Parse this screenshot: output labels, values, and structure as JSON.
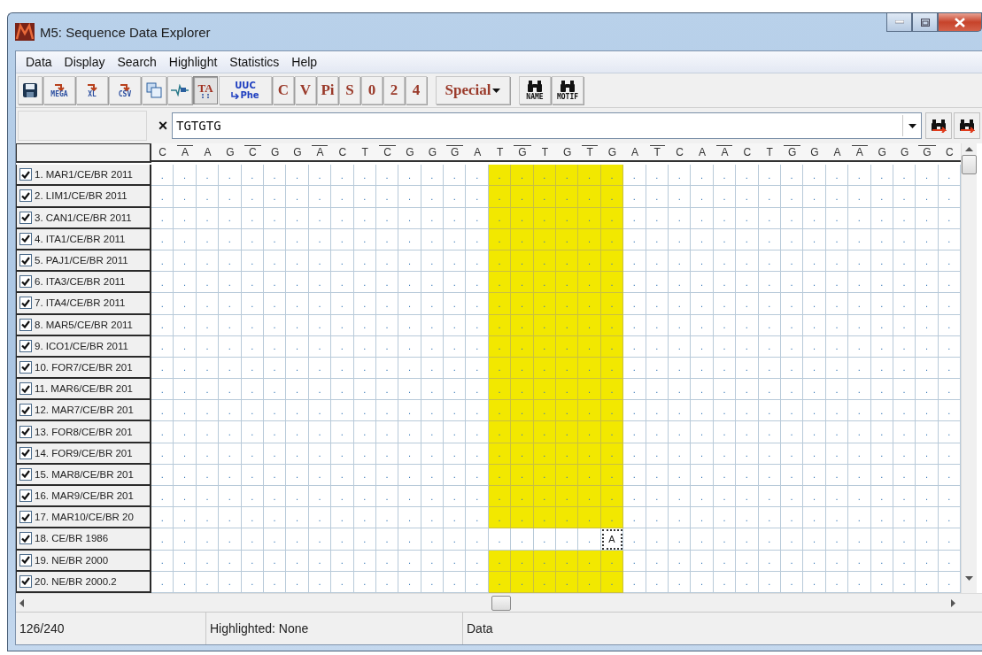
{
  "window": {
    "title": "M5: Sequence Data Explorer"
  },
  "menu": [
    "Data",
    "Display",
    "Search",
    "Highlight",
    "Statistics",
    "Help"
  ],
  "toolbar": [
    {
      "kind": "save"
    },
    {
      "kind": "export",
      "label": "MEGA"
    },
    {
      "kind": "export",
      "label": "XL"
    },
    {
      "kind": "export",
      "label": "CSV"
    },
    {
      "kind": "copy"
    },
    {
      "kind": "chart"
    },
    {
      "kind": "toggle",
      "label": "TA",
      "pressed": true
    },
    {
      "kind": "translate",
      "label": "UUC",
      "sub": "Phe"
    },
    {
      "kind": "letter",
      "label": "C",
      "pressed": false
    },
    {
      "kind": "letter",
      "label": "V",
      "pressed": false
    },
    {
      "kind": "letter",
      "label": "Pi",
      "pressed": false
    },
    {
      "kind": "letter",
      "label": "S",
      "pressed": false
    },
    {
      "kind": "letter",
      "label": "0",
      "pressed": false
    },
    {
      "kind": "letter",
      "label": "2",
      "pressed": false
    },
    {
      "kind": "letter",
      "label": "4",
      "pressed": false
    },
    {
      "kind": "dropdown",
      "label": "Special"
    },
    {
      "kind": "find",
      "label": "NAME"
    },
    {
      "kind": "find",
      "label": "MOTIF"
    }
  ],
  "search": {
    "clear": "×",
    "value": "TGTGTG"
  },
  "columns": [
    {
      "base": "C",
      "marked": false,
      "match": false,
      "cursor": false
    },
    {
      "base": "A",
      "marked": true,
      "match": false,
      "cursor": false
    },
    {
      "base": "A",
      "marked": false,
      "match": false,
      "cursor": false
    },
    {
      "base": "G",
      "marked": false,
      "match": false,
      "cursor": false
    },
    {
      "base": "C",
      "marked": true,
      "match": false,
      "cursor": false
    },
    {
      "base": "G",
      "marked": false,
      "match": false,
      "cursor": false
    },
    {
      "base": "G",
      "marked": false,
      "match": false,
      "cursor": false
    },
    {
      "base": "A",
      "marked": true,
      "match": false,
      "cursor": false
    },
    {
      "base": "C",
      "marked": false,
      "match": false,
      "cursor": false
    },
    {
      "base": "T",
      "marked": false,
      "match": false,
      "cursor": false
    },
    {
      "base": "C",
      "marked": true,
      "match": false,
      "cursor": false
    },
    {
      "base": "G",
      "marked": false,
      "match": false,
      "cursor": false
    },
    {
      "base": "G",
      "marked": false,
      "match": false,
      "cursor": false
    },
    {
      "base": "G",
      "marked": true,
      "match": false,
      "cursor": false
    },
    {
      "base": "A",
      "marked": false,
      "match": false,
      "cursor": false
    },
    {
      "base": "T",
      "marked": false,
      "match": true,
      "cursor": false
    },
    {
      "base": "G",
      "marked": true,
      "match": true,
      "cursor": false
    },
    {
      "base": "T",
      "marked": false,
      "match": true,
      "cursor": false
    },
    {
      "base": "G",
      "marked": false,
      "match": true,
      "cursor": false
    },
    {
      "base": "T",
      "marked": true,
      "match": true,
      "cursor": false
    },
    {
      "base": "G",
      "marked": false,
      "match": true,
      "cursor": true
    },
    {
      "base": "A",
      "marked": false,
      "match": false,
      "cursor": false
    },
    {
      "base": "T",
      "marked": true,
      "match": false,
      "cursor": false
    },
    {
      "base": "C",
      "marked": false,
      "match": false,
      "cursor": false
    },
    {
      "base": "A",
      "marked": false,
      "match": false,
      "cursor": false
    },
    {
      "base": "A",
      "marked": true,
      "match": false,
      "cursor": false
    },
    {
      "base": "C",
      "marked": false,
      "match": false,
      "cursor": false
    },
    {
      "base": "T",
      "marked": false,
      "match": false,
      "cursor": false
    },
    {
      "base": "G",
      "marked": true,
      "match": false,
      "cursor": false
    },
    {
      "base": "G",
      "marked": false,
      "match": false,
      "cursor": false
    },
    {
      "base": "A",
      "marked": false,
      "match": false,
      "cursor": false
    },
    {
      "base": "A",
      "marked": true,
      "match": false,
      "cursor": false
    },
    {
      "base": "G",
      "marked": false,
      "match": false,
      "cursor": false
    },
    {
      "base": "G",
      "marked": false,
      "match": false,
      "cursor": false
    },
    {
      "base": "G",
      "marked": true,
      "match": false,
      "cursor": false
    },
    {
      "base": "C",
      "marked": false,
      "match": false,
      "cursor": false
    }
  ],
  "rows": [
    {
      "label": "1. MAR1/CE/BR 2011",
      "checked": true,
      "highlighted": true,
      "cursor": false,
      "cells": [
        ".",
        ".",
        ".",
        ".",
        ".",
        ".",
        ".",
        ".",
        ".",
        ".",
        ".",
        ".",
        ".",
        ".",
        ".",
        ".",
        ".",
        ".",
        ".",
        ".",
        ".",
        ".",
        ".",
        ".",
        ".",
        ".",
        ".",
        ".",
        ".",
        ".",
        ".",
        ".",
        ".",
        ".",
        ".",
        "."
      ]
    },
    {
      "label": "2. LIM1/CE/BR 2011",
      "checked": true,
      "highlighted": true,
      "cursor": false,
      "cells": [
        ".",
        ".",
        ".",
        ".",
        ".",
        ".",
        ".",
        ".",
        ".",
        ".",
        ".",
        ".",
        ".",
        ".",
        ".",
        ".",
        ".",
        ".",
        ".",
        ".",
        ".",
        ".",
        ".",
        ".",
        ".",
        ".",
        ".",
        ".",
        ".",
        ".",
        ".",
        ".",
        ".",
        ".",
        ".",
        "."
      ]
    },
    {
      "label": "3. CAN1/CE/BR 2011",
      "checked": true,
      "highlighted": true,
      "cursor": false,
      "cells": [
        ".",
        ".",
        ".",
        ".",
        ".",
        ".",
        ".",
        ".",
        ".",
        ".",
        ".",
        ".",
        ".",
        ".",
        ".",
        ".",
        ".",
        ".",
        ".",
        ".",
        ".",
        ".",
        ".",
        ".",
        ".",
        ".",
        ".",
        ".",
        ".",
        ".",
        ".",
        ".",
        ".",
        ".",
        ".",
        "."
      ]
    },
    {
      "label": "4. ITA1/CE/BR 2011",
      "checked": true,
      "highlighted": true,
      "cursor": false,
      "cells": [
        ".",
        ".",
        ".",
        ".",
        ".",
        ".",
        ".",
        ".",
        ".",
        ".",
        ".",
        ".",
        ".",
        ".",
        ".",
        ".",
        ".",
        ".",
        ".",
        ".",
        ".",
        ".",
        ".",
        ".",
        ".",
        ".",
        ".",
        ".",
        ".",
        ".",
        ".",
        ".",
        ".",
        ".",
        ".",
        "."
      ]
    },
    {
      "label": "5. PAJ1/CE/BR 2011",
      "checked": true,
      "highlighted": true,
      "cursor": false,
      "cells": [
        ".",
        ".",
        ".",
        ".",
        ".",
        ".",
        ".",
        ".",
        ".",
        ".",
        ".",
        ".",
        ".",
        ".",
        ".",
        ".",
        ".",
        ".",
        ".",
        ".",
        ".",
        ".",
        ".",
        ".",
        ".",
        ".",
        ".",
        ".",
        ".",
        ".",
        ".",
        ".",
        ".",
        ".",
        ".",
        "."
      ]
    },
    {
      "label": "6. ITA3/CE/BR 2011",
      "checked": true,
      "highlighted": true,
      "cursor": false,
      "cells": [
        ".",
        ".",
        ".",
        ".",
        ".",
        ".",
        ".",
        ".",
        ".",
        ".",
        ".",
        ".",
        ".",
        ".",
        ".",
        ".",
        ".",
        ".",
        ".",
        ".",
        ".",
        ".",
        ".",
        ".",
        ".",
        ".",
        ".",
        ".",
        ".",
        ".",
        ".",
        ".",
        ".",
        ".",
        ".",
        "."
      ]
    },
    {
      "label": "7. ITA4/CE/BR 2011",
      "checked": true,
      "highlighted": true,
      "cursor": false,
      "cells": [
        ".",
        ".",
        ".",
        ".",
        ".",
        ".",
        ".",
        ".",
        ".",
        ".",
        ".",
        ".",
        ".",
        ".",
        ".",
        ".",
        ".",
        ".",
        ".",
        ".",
        ".",
        ".",
        ".",
        ".",
        ".",
        ".",
        ".",
        ".",
        ".",
        ".",
        ".",
        ".",
        ".",
        ".",
        ".",
        "."
      ]
    },
    {
      "label": "8. MAR5/CE/BR 2011",
      "checked": true,
      "highlighted": true,
      "cursor": false,
      "cells": [
        ".",
        ".",
        ".",
        ".",
        ".",
        ".",
        ".",
        ".",
        ".",
        ".",
        ".",
        ".",
        ".",
        ".",
        ".",
        ".",
        ".",
        ".",
        ".",
        ".",
        ".",
        ".",
        ".",
        ".",
        ".",
        ".",
        ".",
        ".",
        ".",
        ".",
        ".",
        ".",
        ".",
        ".",
        ".",
        "."
      ]
    },
    {
      "label": "9. ICO1/CE/BR 2011",
      "checked": true,
      "highlighted": true,
      "cursor": false,
      "cells": [
        ".",
        ".",
        ".",
        ".",
        ".",
        ".",
        ".",
        ".",
        ".",
        ".",
        ".",
        ".",
        ".",
        ".",
        ".",
        ".",
        ".",
        ".",
        ".",
        ".",
        ".",
        ".",
        ".",
        ".",
        ".",
        ".",
        ".",
        ".",
        ".",
        ".",
        ".",
        ".",
        ".",
        ".",
        ".",
        "."
      ]
    },
    {
      "label": "10. FOR7/CE/BR 201",
      "checked": true,
      "highlighted": true,
      "cursor": false,
      "cells": [
        ".",
        ".",
        ".",
        ".",
        ".",
        ".",
        ".",
        ".",
        ".",
        ".",
        ".",
        ".",
        ".",
        ".",
        ".",
        ".",
        ".",
        ".",
        ".",
        ".",
        ".",
        ".",
        ".",
        ".",
        ".",
        ".",
        ".",
        ".",
        ".",
        ".",
        ".",
        ".",
        ".",
        ".",
        ".",
        "."
      ]
    },
    {
      "label": "11. MAR6/CE/BR 201",
      "checked": true,
      "highlighted": true,
      "cursor": false,
      "cells": [
        ".",
        ".",
        ".",
        ".",
        ".",
        ".",
        ".",
        ".",
        ".",
        ".",
        ".",
        ".",
        ".",
        ".",
        ".",
        ".",
        ".",
        ".",
        ".",
        ".",
        ".",
        ".",
        ".",
        ".",
        ".",
        ".",
        ".",
        ".",
        ".",
        ".",
        ".",
        ".",
        ".",
        ".",
        ".",
        "."
      ]
    },
    {
      "label": "12. MAR7/CE/BR 201",
      "checked": true,
      "highlighted": true,
      "cursor": false,
      "cells": [
        ".",
        ".",
        ".",
        ".",
        ".",
        ".",
        ".",
        ".",
        ".",
        ".",
        ".",
        ".",
        ".",
        ".",
        ".",
        ".",
        ".",
        ".",
        ".",
        ".",
        ".",
        ".",
        ".",
        ".",
        ".",
        ".",
        ".",
        ".",
        ".",
        ".",
        ".",
        ".",
        ".",
        ".",
        ".",
        "."
      ]
    },
    {
      "label": "13. FOR8/CE/BR 201",
      "checked": true,
      "highlighted": true,
      "cursor": false,
      "cells": [
        ".",
        ".",
        ".",
        ".",
        ".",
        ".",
        ".",
        ".",
        ".",
        ".",
        ".",
        ".",
        ".",
        ".",
        ".",
        ".",
        ".",
        ".",
        ".",
        ".",
        ".",
        ".",
        ".",
        ".",
        ".",
        ".",
        ".",
        ".",
        ".",
        ".",
        ".",
        ".",
        ".",
        ".",
        ".",
        "."
      ]
    },
    {
      "label": "14. FOR9/CE/BR 201",
      "checked": true,
      "highlighted": true,
      "cursor": false,
      "cells": [
        ".",
        ".",
        ".",
        ".",
        ".",
        ".",
        ".",
        ".",
        ".",
        ".",
        ".",
        ".",
        ".",
        ".",
        ".",
        ".",
        ".",
        ".",
        ".",
        ".",
        ".",
        ".",
        ".",
        ".",
        ".",
        ".",
        ".",
        ".",
        ".",
        ".",
        ".",
        ".",
        ".",
        ".",
        ".",
        "."
      ]
    },
    {
      "label": "15. MAR8/CE/BR 201",
      "checked": true,
      "highlighted": true,
      "cursor": false,
      "cells": [
        ".",
        ".",
        ".",
        ".",
        ".",
        ".",
        ".",
        ".",
        ".",
        ".",
        ".",
        ".",
        ".",
        ".",
        ".",
        ".",
        ".",
        ".",
        ".",
        ".",
        ".",
        ".",
        ".",
        ".",
        ".",
        ".",
        ".",
        ".",
        ".",
        ".",
        ".",
        ".",
        ".",
        ".",
        ".",
        "."
      ]
    },
    {
      "label": "16. MAR9/CE/BR 201",
      "checked": true,
      "highlighted": true,
      "cursor": false,
      "cells": [
        ".",
        ".",
        ".",
        ".",
        ".",
        ".",
        ".",
        ".",
        ".",
        ".",
        ".",
        ".",
        ".",
        ".",
        ".",
        ".",
        ".",
        ".",
        ".",
        ".",
        ".",
        ".",
        ".",
        ".",
        ".",
        ".",
        ".",
        ".",
        ".",
        ".",
        ".",
        ".",
        ".",
        ".",
        ".",
        "."
      ]
    },
    {
      "label": "17. MAR10/CE/BR 20",
      "checked": true,
      "highlighted": true,
      "cursor": false,
      "cells": [
        ".",
        ".",
        ".",
        ".",
        ".",
        ".",
        ".",
        ".",
        ".",
        ".",
        ".",
        ".",
        ".",
        ".",
        ".",
        ".",
        ".",
        ".",
        ".",
        ".",
        ".",
        ".",
        ".",
        ".",
        ".",
        ".",
        ".",
        ".",
        ".",
        ".",
        ".",
        ".",
        ".",
        ".",
        ".",
        "."
      ]
    },
    {
      "label": "18. CE/BR 1986",
      "checked": true,
      "highlighted": false,
      "cursor": true,
      "cells": [
        ".",
        ".",
        ".",
        ".",
        ".",
        ".",
        ".",
        ".",
        ".",
        ".",
        ".",
        ".",
        ".",
        ".",
        ".",
        ".",
        ".",
        ".",
        ".",
        ".",
        "A",
        ".",
        ".",
        ".",
        ".",
        ".",
        ".",
        ".",
        ".",
        ".",
        ".",
        ".",
        ".",
        ".",
        ".",
        "."
      ]
    },
    {
      "label": "19. NE/BR 2000",
      "checked": true,
      "highlighted": true,
      "cursor": false,
      "cells": [
        ".",
        ".",
        ".",
        ".",
        ".",
        ".",
        ".",
        ".",
        ".",
        ".",
        ".",
        ".",
        ".",
        ".",
        ".",
        ".",
        ".",
        ".",
        ".",
        ".",
        ".",
        ".",
        ".",
        ".",
        ".",
        ".",
        ".",
        ".",
        ".",
        ".",
        ".",
        ".",
        ".",
        ".",
        ".",
        "."
      ]
    },
    {
      "label": "20. NE/BR 2000.2",
      "checked": true,
      "highlighted": true,
      "cursor": false,
      "cells": [
        ".",
        ".",
        ".",
        ".",
        ".",
        ".",
        ".",
        ".",
        ".",
        ".",
        ".",
        ".",
        ".",
        ".",
        ".",
        ".",
        ".",
        ".",
        ".",
        ".",
        ".",
        ".",
        ".",
        ".",
        ".",
        ".",
        ".",
        ".",
        ".",
        ".",
        ".",
        ".",
        ".",
        ".",
        ".",
        "."
      ]
    }
  ],
  "status_bar": [
    "126/240",
    "Highlighted: None",
    "Data"
  ]
}
